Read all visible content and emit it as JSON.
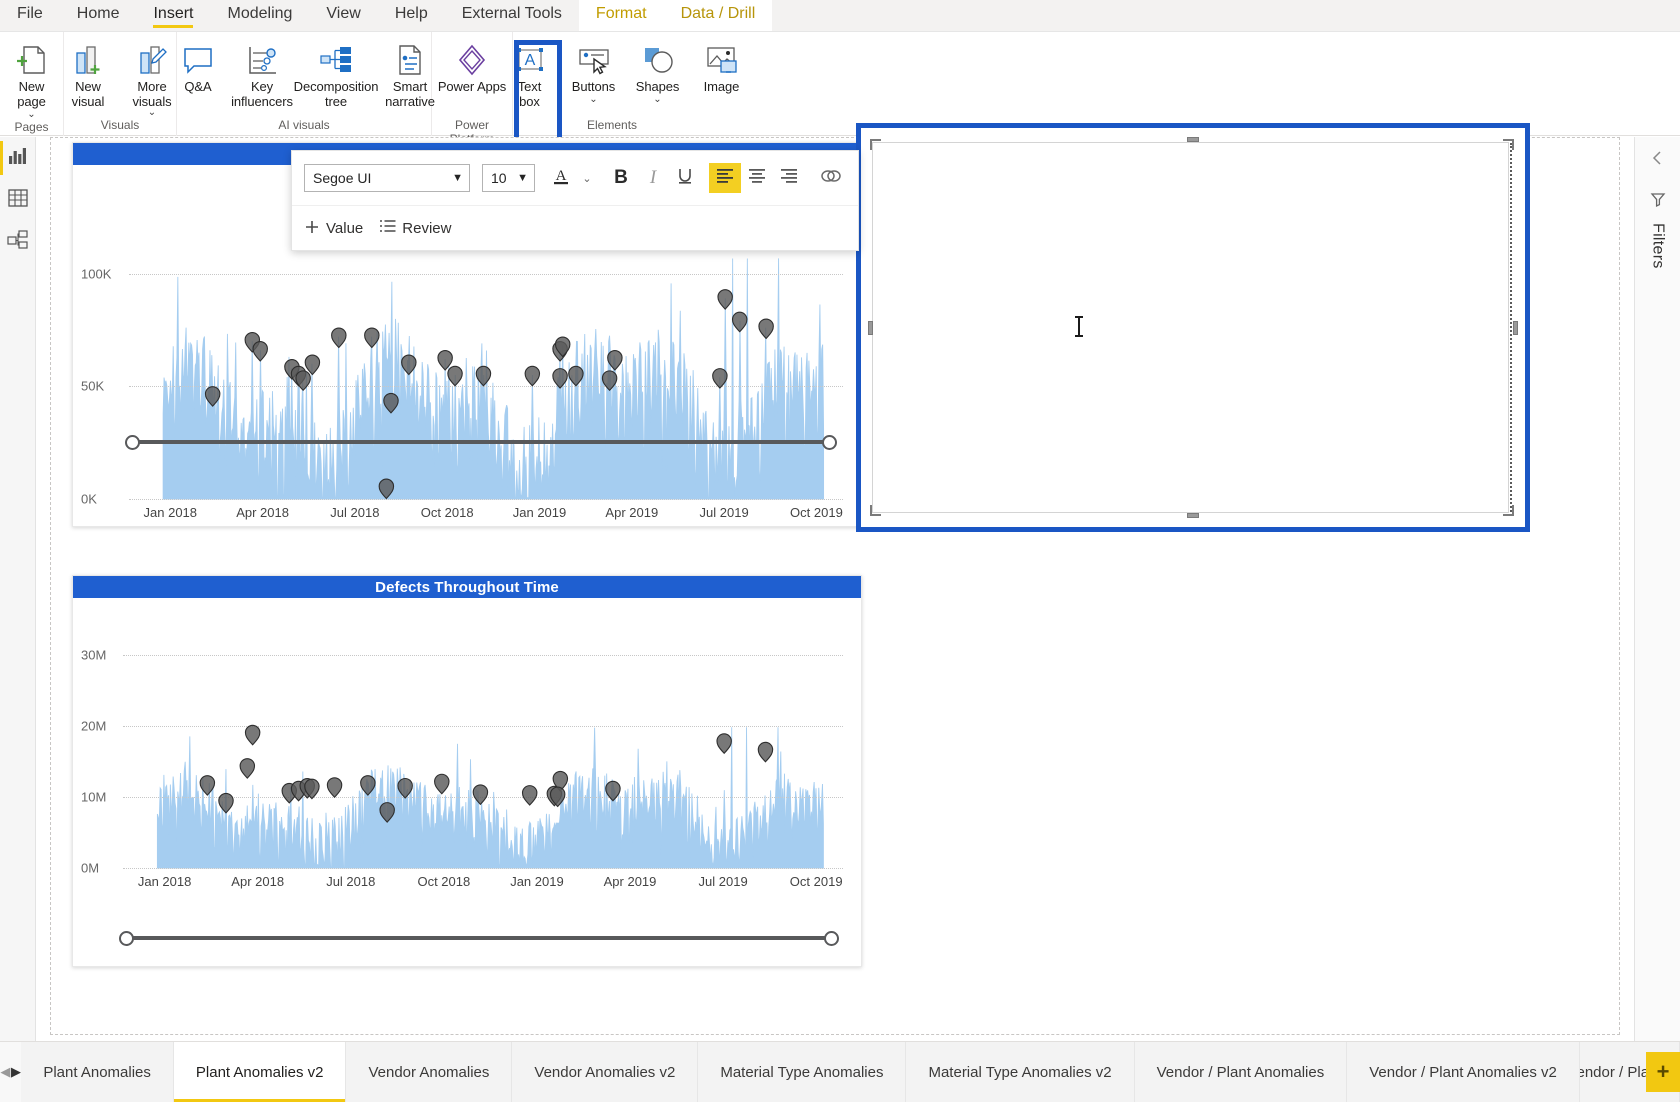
{
  "ribbon": {
    "tabs": [
      {
        "label": "File",
        "state": "normal"
      },
      {
        "label": "Home",
        "state": "normal"
      },
      {
        "label": "Insert",
        "state": "active"
      },
      {
        "label": "Modeling",
        "state": "normal"
      },
      {
        "label": "View",
        "state": "normal"
      },
      {
        "label": "Help",
        "state": "normal"
      },
      {
        "label": "External Tools",
        "state": "normal"
      }
    ],
    "contextual_tabs": [
      {
        "label": "Format",
        "state": "context"
      },
      {
        "label": "Data / Drill",
        "state": "context-selected"
      }
    ],
    "groups": [
      {
        "label": "Pages",
        "buttons": [
          {
            "name": "new-page",
            "label": "New\npage",
            "icon": "new-page-icon",
            "dropdown": true
          }
        ]
      },
      {
        "label": "Visuals",
        "buttons": [
          {
            "name": "new-visual",
            "label": "New\nvisual",
            "icon": "new-visual-icon",
            "dropdown": false
          },
          {
            "name": "more-visuals",
            "label": "More\nvisuals",
            "icon": "more-visuals-icon",
            "dropdown": true
          }
        ]
      },
      {
        "label": "AI visuals",
        "buttons": [
          {
            "name": "qna",
            "label": "Q&A",
            "icon": "qna-icon",
            "dropdown": false
          },
          {
            "name": "key-influencers",
            "label": "Key\ninfluencers",
            "icon": "key-influencers-icon",
            "dropdown": false
          },
          {
            "name": "decomposition-tree",
            "label": "Decomposition\ntree",
            "icon": "decomposition-tree-icon",
            "dropdown": false
          },
          {
            "name": "smart-narrative",
            "label": "Smart\nnarrative",
            "icon": "smart-narrative-icon",
            "dropdown": false
          }
        ]
      },
      {
        "label": "Power Platform",
        "buttons": [
          {
            "name": "power-apps",
            "label": "Power Apps",
            "icon": "power-apps-icon",
            "dropdown": false
          }
        ]
      },
      {
        "label": "Elements",
        "buttons": [
          {
            "name": "text-box",
            "label": "Text\nbox",
            "icon": "text-box-icon",
            "dropdown": false,
            "selected": true
          },
          {
            "name": "buttons",
            "label": "Buttons",
            "icon": "buttons-icon",
            "dropdown": true
          },
          {
            "name": "shapes",
            "label": "Shapes",
            "icon": "shapes-icon",
            "dropdown": true
          },
          {
            "name": "image",
            "label": "Image",
            "icon": "image-icon",
            "dropdown": false
          }
        ]
      }
    ]
  },
  "left_rail": {
    "items": [
      {
        "name": "report-view",
        "icon": "report-bar-chart-icon",
        "active": true
      },
      {
        "name": "data-view",
        "icon": "data-table-icon",
        "active": false
      },
      {
        "name": "model-view",
        "icon": "model-relationships-icon",
        "active": false
      }
    ]
  },
  "format_toolbar": {
    "font_family": "Segoe UI",
    "font_size": "10",
    "buttons": [
      {
        "name": "font-color",
        "icon": "font-color-A-icon",
        "label": "A"
      },
      {
        "name": "font-color-dropdown",
        "icon": "chevron-down-icon",
        "label": ""
      },
      {
        "name": "bold",
        "icon": "bold-icon",
        "label": "B"
      },
      {
        "name": "italic",
        "icon": "italic-icon",
        "label": "I"
      },
      {
        "name": "underline",
        "icon": "underline-icon",
        "label": "U"
      },
      {
        "name": "align-left",
        "icon": "align-left-icon",
        "label": "",
        "active": true
      },
      {
        "name": "align-center",
        "icon": "align-center-icon",
        "label": ""
      },
      {
        "name": "align-right",
        "icon": "align-right-icon",
        "label": ""
      },
      {
        "name": "insert-link",
        "icon": "link-icon",
        "label": ""
      }
    ],
    "chips": [
      {
        "name": "add-value",
        "label": "Value",
        "icon": "plus-icon"
      },
      {
        "name": "review",
        "label": "Review",
        "icon": "list-review-icon"
      }
    ],
    "highlight_color": "#f3cf22"
  },
  "textbox": {
    "name": "inserted-text-box",
    "value": "",
    "placeholder": "",
    "selected": true,
    "selection_color": "#1a56c4"
  },
  "right_pane": {
    "collapse_icon": "chevron-left-icon",
    "filter_icon": "filter-funnel-icon",
    "label": "Filters"
  },
  "page_tabs": {
    "prev_icon": "chevron-left-icon",
    "next_icon": "chevron-right-icon",
    "add_label": "+",
    "tabs": [
      {
        "label": "Plant Anomalies",
        "active": false
      },
      {
        "label": "Plant Anomalies v2",
        "active": true
      },
      {
        "label": "Vendor Anomalies",
        "active": false
      },
      {
        "label": "Vendor Anomalies v2",
        "active": false
      },
      {
        "label": "Material Type Anomalies",
        "active": false
      },
      {
        "label": "Material Type Anomalies v2",
        "active": false
      },
      {
        "label": "Vendor / Plant Anomalies",
        "active": false
      },
      {
        "label": "Vendor / Plant Anomalies v2",
        "active": false
      },
      {
        "label": "Vendor / Plant Ano",
        "active": false,
        "clipped": true
      }
    ]
  },
  "chart_data": [
    {
      "id": "top-chart",
      "type": "line",
      "title": "",
      "accent_color": "#a5cdf0",
      "marker_color": "#5a5a5a",
      "xlabel": "",
      "ylabel": "",
      "ylim": [
        0,
        110000
      ],
      "yticks": [
        "0K",
        "50K",
        "100K"
      ],
      "ytick_values": [
        0,
        50000,
        100000
      ],
      "xticks": [
        "Jan 2018",
        "Apr 2018",
        "Jul 2018",
        "Oct 2018",
        "Jan 2019",
        "Apr 2019",
        "Jul 2019",
        "Oct 2019"
      ],
      "grid": true,
      "legend": "none",
      "anomaly_points": [
        {
          "x": 0.075,
          "y": 46000
        },
        {
          "x": 0.135,
          "y": 70000
        },
        {
          "x": 0.147,
          "y": 66000
        },
        {
          "x": 0.195,
          "y": 58000
        },
        {
          "x": 0.205,
          "y": 55000
        },
        {
          "x": 0.212,
          "y": 53000
        },
        {
          "x": 0.226,
          "y": 60000
        },
        {
          "x": 0.266,
          "y": 72000
        },
        {
          "x": 0.316,
          "y": 72000
        },
        {
          "x": 0.345,
          "y": 43000
        },
        {
          "x": 0.372,
          "y": 60000
        },
        {
          "x": 0.427,
          "y": 62000
        },
        {
          "x": 0.442,
          "y": 55000
        },
        {
          "x": 0.485,
          "y": 55000
        },
        {
          "x": 0.559,
          "y": 55000
        },
        {
          "x": 0.601,
          "y": 66000
        },
        {
          "x": 0.605,
          "y": 68000
        },
        {
          "x": 0.601,
          "y": 54000
        },
        {
          "x": 0.625,
          "y": 55000
        },
        {
          "x": 0.684,
          "y": 62000
        },
        {
          "x": 0.676,
          "y": 53000
        },
        {
          "x": 0.338,
          "y": 5000
        },
        {
          "x": 0.851,
          "y": 89000
        },
        {
          "x": 0.873,
          "y": 79000
        },
        {
          "x": 0.843,
          "y": 54000
        },
        {
          "x": 0.913,
          "y": 76000
        }
      ],
      "slider": {
        "start": 0.0,
        "end": 1.0
      }
    },
    {
      "id": "bottom-chart",
      "type": "line",
      "title": "Defects Throughout Time",
      "accent_color": "#a5cdf0",
      "marker_color": "#5a5a5a",
      "xlabel": "",
      "ylabel": "",
      "ylim": [
        0,
        33000000
      ],
      "yticks": [
        "0M",
        "10M",
        "20M",
        "30M"
      ],
      "ytick_values": [
        0,
        10000000,
        20000000,
        30000000
      ],
      "xticks": [
        "Jan 2018",
        "Apr 2018",
        "Jul 2018",
        "Oct 2018",
        "Jan 2019",
        "Apr 2019",
        "Jul 2019",
        "Oct 2019"
      ],
      "grid": true,
      "legend": "none",
      "anomaly_points": [
        {
          "x": 0.075,
          "y": 11800000
        },
        {
          "x": 0.103,
          "y": 9300000
        },
        {
          "x": 0.135,
          "y": 14200000
        },
        {
          "x": 0.143,
          "y": 18900000
        },
        {
          "x": 0.198,
          "y": 10700000
        },
        {
          "x": 0.212,
          "y": 11000000
        },
        {
          "x": 0.225,
          "y": 11400000
        },
        {
          "x": 0.232,
          "y": 11300000
        },
        {
          "x": 0.266,
          "y": 11500000
        },
        {
          "x": 0.316,
          "y": 11800000
        },
        {
          "x": 0.345,
          "y": 8000000
        },
        {
          "x": 0.372,
          "y": 11400000
        },
        {
          "x": 0.427,
          "y": 12000000
        },
        {
          "x": 0.485,
          "y": 10500000
        },
        {
          "x": 0.559,
          "y": 10400000
        },
        {
          "x": 0.596,
          "y": 10300000
        },
        {
          "x": 0.605,
          "y": 12400000
        },
        {
          "x": 0.601,
          "y": 10200000
        },
        {
          "x": 0.684,
          "y": 11000000
        },
        {
          "x": 0.851,
          "y": 17700000
        },
        {
          "x": 0.913,
          "y": 16500000
        }
      ],
      "slider": {
        "start": 0.0,
        "end": 1.0
      }
    }
  ]
}
